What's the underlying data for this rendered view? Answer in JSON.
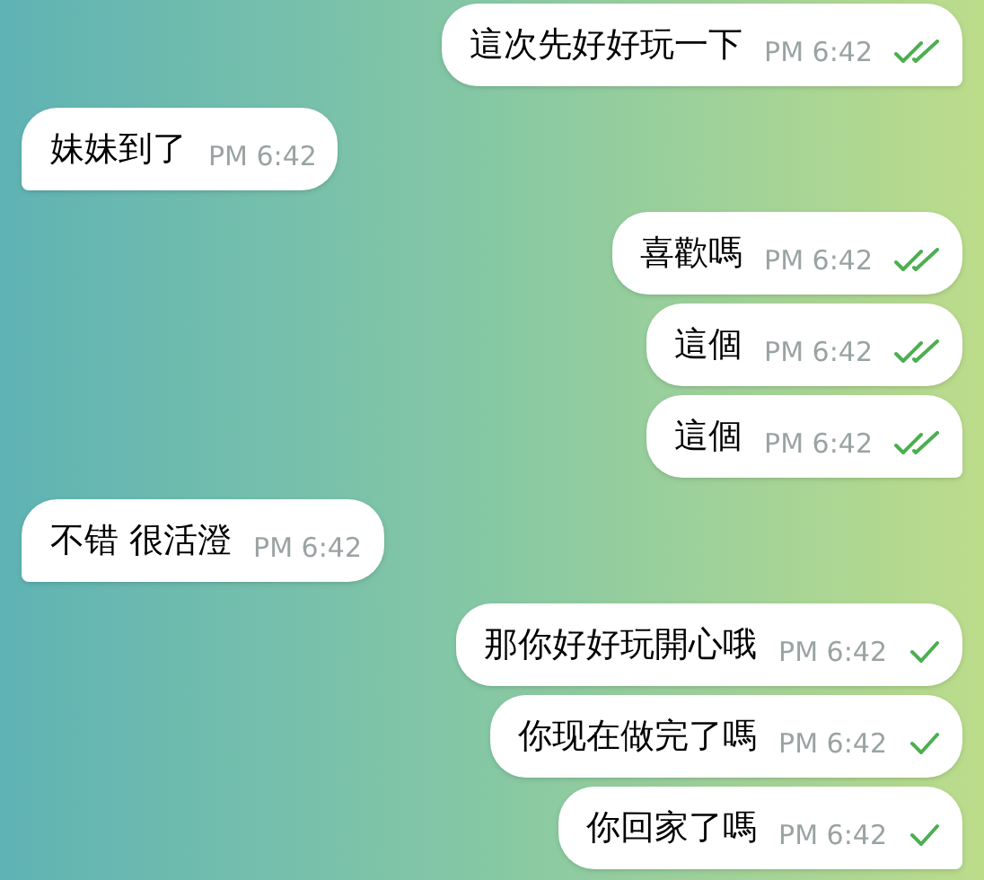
{
  "messages": [
    {
      "kind": "outgoing",
      "text": "這次先好好玩一下",
      "time": "PM 6:42",
      "read": true
    },
    {
      "kind": "incoming",
      "text": "妹妹到了",
      "time": "PM 6:42"
    },
    {
      "kind": "outgoing",
      "text": "喜歡嗎",
      "time": "PM 6:42",
      "read": true
    },
    {
      "kind": "outgoing",
      "text": "這個",
      "time": "PM 6:42",
      "read": true
    },
    {
      "kind": "outgoing",
      "text": "這個",
      "time": "PM 6:42",
      "read": true
    },
    {
      "kind": "incoming",
      "text": "不错 很活澄",
      "time": "PM 6:42"
    },
    {
      "kind": "outgoing",
      "text": "那你好好玩開心哦",
      "time": "PM 6:42",
      "read": false
    },
    {
      "kind": "outgoing",
      "text": "你现在做完了嗎",
      "time": "PM 6:42",
      "read": false
    },
    {
      "kind": "outgoing",
      "text": "你回家了嗎",
      "time": "PM 6:42",
      "read": false
    }
  ]
}
